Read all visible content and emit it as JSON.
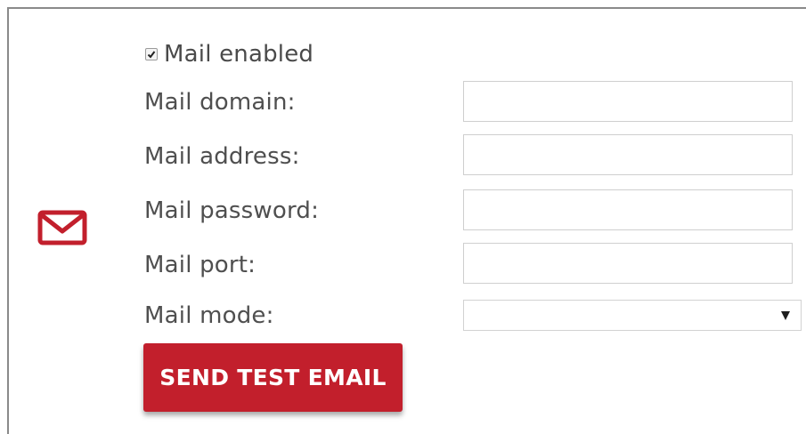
{
  "settings": {
    "mail_enabled": {
      "label": "Mail enabled",
      "checked": true
    },
    "fields": [
      {
        "label": "Mail domain:",
        "value": ""
      },
      {
        "label": "Mail address:",
        "value": ""
      },
      {
        "label": "Mail password:",
        "value": ""
      },
      {
        "label": "Mail port:",
        "value": ""
      }
    ],
    "mail_mode": {
      "label": "Mail mode:",
      "selected": ""
    },
    "send_test_email_label": "SEND TEST EMAIL"
  },
  "icons": {
    "mail": "envelope-icon",
    "dropdown": "triangle-down-icon"
  },
  "colors": {
    "accent": "#c21f2c",
    "border": "#cfcfcf",
    "label_text": "#4f4f4f"
  }
}
